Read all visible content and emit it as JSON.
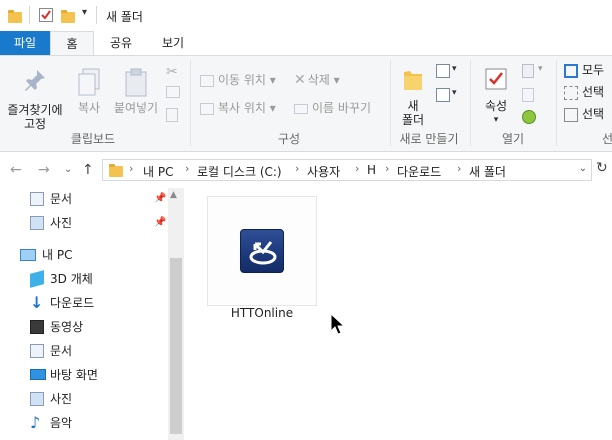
{
  "window": {
    "title": "새 폴더"
  },
  "tabs": [
    {
      "label": "파일"
    },
    {
      "label": "홈"
    },
    {
      "label": "공유"
    },
    {
      "label": "보기"
    }
  ],
  "ribbon": {
    "clipboard": {
      "label": "클립보드",
      "pin_label_line1": "즐겨찾기에",
      "pin_label_line2": "고정",
      "copy_label": "복사",
      "paste_label": "붙여넣기"
    },
    "organize": {
      "label": "구성",
      "move_to": "이동 위치",
      "copy_to": "복사 위치",
      "delete": "삭제",
      "rename": "이름 바꾸기"
    },
    "new": {
      "label": "새로 만들기",
      "new_folder_line1": "새",
      "new_folder_line2": "폴더"
    },
    "open": {
      "label": "열기",
      "properties": "속성"
    },
    "select": {
      "label": "선",
      "select_all": "모두",
      "select_none": "선택",
      "invert_selection": "선택"
    }
  },
  "address": {
    "crumbs": [
      "내 PC",
      "로컬 디스크 (C:)",
      "사용자",
      "H",
      "다운로드",
      "새 폴더"
    ]
  },
  "navpane": {
    "quick_items": [
      {
        "label": "문서",
        "icon": "documents-icon"
      },
      {
        "label": "사진",
        "icon": "pictures-icon"
      }
    ],
    "this_pc": {
      "label": "내 PC",
      "icon": "computer-icon"
    },
    "pc_items": [
      {
        "label": "3D 개체",
        "icon": "3d-objects-icon"
      },
      {
        "label": "다운로드",
        "icon": "downloads-icon"
      },
      {
        "label": "동영상",
        "icon": "videos-icon"
      },
      {
        "label": "문서",
        "icon": "documents-icon"
      },
      {
        "label": "바탕 화면",
        "icon": "desktop-icon"
      },
      {
        "label": "사진",
        "icon": "pictures-icon"
      },
      {
        "label": "음악",
        "icon": "music-icon"
      }
    ]
  },
  "content": {
    "files": [
      {
        "name": "HTTOnline",
        "icon": "app-icon"
      }
    ]
  },
  "colors": {
    "accent": "#1979ca",
    "folder": "#f3c24f",
    "ribbon_bg": "#f5f6f7"
  }
}
